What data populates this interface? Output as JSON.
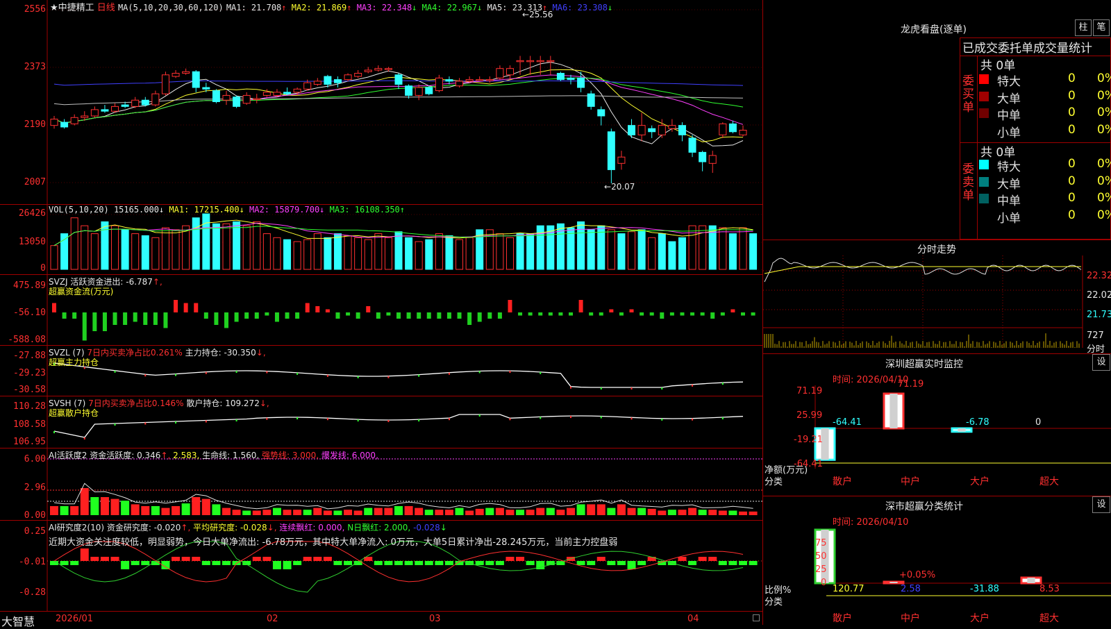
{
  "app": {
    "brand": "大智慧"
  },
  "main": {
    "title": "★中捷精工",
    "period": "日线",
    "ma_text": "MA(5,10,20,30,60,120)",
    "ma": [
      {
        "label": "MA1:",
        "value": "21.708",
        "dir": "↑",
        "color": "#e8e8e8"
      },
      {
        "label": "MA2:",
        "value": "21.869",
        "dir": "↑",
        "color": "#ffff30"
      },
      {
        "label": "MA3:",
        "value": "22.348",
        "dir": "↓",
        "color": "#ff40ff"
      },
      {
        "label": "MA4:",
        "value": "22.967",
        "dir": "↓",
        "color": "#30ff30"
      },
      {
        "label": "MA5:",
        "value": "23.313",
        "dir": "↑",
        "color": "#e8e8e8"
      },
      {
        "label": "MA6:",
        "value": "23.308",
        "dir": "↓",
        "color": "#4040ff"
      }
    ],
    "y_ticks": [
      "2556",
      "2373",
      "2190",
      "2007"
    ],
    "high_label": "25.56",
    "low_label": "20.07"
  },
  "vol": {
    "header": "VOL(5,10,20)",
    "value": "15165.000↓",
    "ma1": "MA1: 17215.400↓",
    "ma2": "MA2: 15879.700↓",
    "ma3": "MA3: 16108.350↑",
    "y_ticks": [
      "26426",
      "13050",
      "0"
    ]
  },
  "svzj": {
    "header": "SVZJ  活跃资金进出: -6.787",
    "arrow": "↑,",
    "sub": "超赢资金流(万元)",
    "y_ticks": [
      "475.89",
      "-56.10",
      "-588.08"
    ]
  },
  "svzl": {
    "header": "SVZL (7)",
    "red": "7日内买卖净占比0.261%",
    "white": "主力持仓: -30.350",
    "arrow": "↓,",
    "sub": "超赢主力持仓",
    "y_ticks": [
      "-27.88",
      "-29.23",
      "-30.58"
    ]
  },
  "svsh": {
    "header": "SVSH (7)",
    "red": "7日内买卖净占比0.146%",
    "white": "散户持仓: 109.272",
    "arrow": "↓,",
    "sub": "超赢散户持仓",
    "y_ticks": [
      "110.28",
      "108.58",
      "106.95"
    ]
  },
  "ai1": {
    "header": "AI活跃度2",
    "white": "资金活跃度: 0.346",
    "arrow": "↑,",
    "v2": "2.583,",
    "life": "生命线: 1.560,",
    "strong": "强势线: 3.000,",
    "burst": "爆发线: 6.000,",
    "y_ticks": [
      "6.00",
      "2.96",
      "0.00"
    ]
  },
  "ai2": {
    "header": "AI研究度2(10)",
    "white": "资金研究度: -0.020",
    "a1": "↑,",
    "avg": "平均研究度: -0.028",
    "a2": "↓,",
    "lianxu": "连续飘红: 0.000,",
    "nday": "N日飘红: 2.000,",
    "blue": "-0.028",
    "a3": "↓",
    "note": "近期大资金关注度较低，明显弱势，今日大单净流出: -6.78万元，其中特大单净流入: 0万元，大单5日累计净出-28.245万元，当前主力控盘弱",
    "y_ticks": [
      "0.25",
      "-0.01",
      "-0.28"
    ]
  },
  "xaxis": {
    "labels": [
      "2026/01",
      "02",
      "03",
      "04"
    ]
  },
  "dragon": {
    "title": "龙虎看盘(逐单)",
    "btn1": "柱",
    "btn2": "笔",
    "header": "已成交委托单成交量统计",
    "buy_side": "委买单",
    "sell_side": "委卖单",
    "buy_total": "共 0单",
    "sell_total": "共 0单",
    "buy_rows": [
      {
        "label": "特大",
        "count": "0",
        "pct": "0%",
        "color": "#ff0000"
      },
      {
        "label": "大单",
        "count": "0",
        "pct": "0%",
        "color": "#a00000"
      },
      {
        "label": "中单",
        "count": "0",
        "pct": "0%",
        "color": "#700000"
      },
      {
        "label": "小单",
        "count": "0",
        "pct": "0%",
        "color": "#000000"
      }
    ],
    "sell_rows": [
      {
        "label": "特大",
        "count": "0",
        "pct": "0%",
        "color": "#00ffff"
      },
      {
        "label": "大单",
        "count": "0",
        "pct": "0%",
        "color": "#008080"
      },
      {
        "label": "中单",
        "count": "0",
        "pct": "0%",
        "color": "#006060"
      },
      {
        "label": "小单",
        "count": "0",
        "pct": "0%",
        "color": "#000000"
      }
    ]
  },
  "intraday": {
    "title": "分时走势",
    "y_ticks": [
      "22.32",
      "22.02",
      "21.73"
    ],
    "vol_label": "727",
    "vol_unit": "分时"
  },
  "monitor": {
    "title": "深圳超赢实时监控",
    "set": "设",
    "time": "时间: 2026/04/10",
    "y_ticks": [
      "71.19",
      "25.99",
      "-19.21",
      "-64.41"
    ],
    "values": {
      "retail": "-64.41",
      "mid": "71.19",
      "big": "-6.78",
      "super": "0"
    },
    "unit": "净额(万元)",
    "cat": "分类",
    "categories": [
      "散户",
      "中户",
      "大户",
      "超大"
    ]
  },
  "classify": {
    "title": "深市超赢分类统计",
    "set": "设",
    "time": "时间: 2026/04/10",
    "y_ticks": [
      "75",
      "50",
      "25",
      "0"
    ],
    "mid_pct": "+0.05%",
    "unit": "比例%",
    "cat": "分类",
    "values": [
      "120.77",
      "2.58",
      "-31.88",
      "8.53"
    ],
    "categories": [
      "散户",
      "中户",
      "大户",
      "超大"
    ]
  },
  "chart_data": {
    "type": "candlestick",
    "note_units": "price ×100 on axis",
    "candles": [
      {
        "o": 21.9,
        "c": 22.1,
        "h": 22.2,
        "l": 21.8
      },
      {
        "o": 22.0,
        "c": 21.85,
        "h": 22.1,
        "l": 21.8
      },
      {
        "o": 21.95,
        "c": 22.15,
        "h": 22.25,
        "l": 21.9
      },
      {
        "o": 22.15,
        "c": 22.2,
        "h": 22.35,
        "l": 22.05
      },
      {
        "o": 22.2,
        "c": 22.4,
        "h": 22.5,
        "l": 22.15
      },
      {
        "o": 22.4,
        "c": 22.35,
        "h": 22.55,
        "l": 22.3
      },
      {
        "o": 22.35,
        "c": 22.5,
        "h": 22.6,
        "l": 22.3
      },
      {
        "o": 22.55,
        "c": 22.5,
        "h": 22.65,
        "l": 22.45
      },
      {
        "o": 22.5,
        "c": 22.7,
        "h": 22.8,
        "l": 22.45
      },
      {
        "o": 22.7,
        "c": 22.55,
        "h": 22.8,
        "l": 22.5
      },
      {
        "o": 22.55,
        "c": 22.9,
        "h": 23.0,
        "l": 22.5
      },
      {
        "o": 22.9,
        "c": 23.5,
        "h": 23.6,
        "l": 22.85
      },
      {
        "o": 23.45,
        "c": 23.55,
        "h": 23.65,
        "l": 23.4
      },
      {
        "o": 23.55,
        "c": 23.6,
        "h": 23.7,
        "l": 23.5
      },
      {
        "o": 23.6,
        "c": 23.1,
        "h": 23.65,
        "l": 22.95
      },
      {
        "o": 23.1,
        "c": 23.05,
        "h": 23.25,
        "l": 22.95
      },
      {
        "o": 23.0,
        "c": 22.65,
        "h": 23.05,
        "l": 22.6
      },
      {
        "o": 22.7,
        "c": 22.85,
        "h": 23.0,
        "l": 22.55
      },
      {
        "o": 22.8,
        "c": 22.5,
        "h": 22.85,
        "l": 22.45
      },
      {
        "o": 22.6,
        "c": 22.85,
        "h": 22.95,
        "l": 22.55
      },
      {
        "o": 22.75,
        "c": 22.75,
        "h": 22.9,
        "l": 22.6
      },
      {
        "o": 22.85,
        "c": 22.95,
        "h": 23.05,
        "l": 22.8
      },
      {
        "o": 22.85,
        "c": 22.95,
        "h": 23.05,
        "l": 22.8
      },
      {
        "o": 22.95,
        "c": 22.9,
        "h": 23.1,
        "l": 22.85
      },
      {
        "o": 22.95,
        "c": 23.05,
        "h": 23.1,
        "l": 22.85
      },
      {
        "o": 23.05,
        "c": 23.25,
        "h": 23.35,
        "l": 23.0
      },
      {
        "o": 23.2,
        "c": 23.3,
        "h": 23.4,
        "l": 23.15
      },
      {
        "o": 23.45,
        "c": 23.2,
        "h": 23.5,
        "l": 23.1
      },
      {
        "o": 23.35,
        "c": 23.25,
        "h": 23.45,
        "l": 23.1
      },
      {
        "o": 23.35,
        "c": 23.5,
        "h": 23.55,
        "l": 23.3
      },
      {
        "o": 23.45,
        "c": 23.55,
        "h": 23.65,
        "l": 23.4
      },
      {
        "o": 23.6,
        "c": 23.65,
        "h": 23.75,
        "l": 23.55
      },
      {
        "o": 23.65,
        "c": 23.7,
        "h": 23.8,
        "l": 23.6
      },
      {
        "o": 23.7,
        "c": 23.7,
        "h": 23.75,
        "l": 23.6
      },
      {
        "o": 23.5,
        "c": 23.2,
        "h": 23.55,
        "l": 23.05
      },
      {
        "o": 23.15,
        "c": 22.85,
        "h": 23.2,
        "l": 22.75
      },
      {
        "o": 22.85,
        "c": 23.1,
        "h": 23.2,
        "l": 22.7
      },
      {
        "o": 23.1,
        "c": 22.9,
        "h": 23.15,
        "l": 22.85
      },
      {
        "o": 23.0,
        "c": 23.4,
        "h": 23.5,
        "l": 22.95
      },
      {
        "o": 23.35,
        "c": 23.3,
        "h": 23.45,
        "l": 23.2
      },
      {
        "o": 23.15,
        "c": 23.3,
        "h": 23.4,
        "l": 23.1
      },
      {
        "o": 23.3,
        "c": 23.35,
        "h": 23.45,
        "l": 23.25
      },
      {
        "o": 23.35,
        "c": 23.35,
        "h": 23.45,
        "l": 23.3
      },
      {
        "o": 23.35,
        "c": 23.35,
        "h": 23.45,
        "l": 23.25
      },
      {
        "o": 23.4,
        "c": 23.7,
        "h": 23.8,
        "l": 23.35
      },
      {
        "o": 23.5,
        "c": 23.7,
        "h": 23.8,
        "l": 23.35
      },
      {
        "o": 23.95,
        "c": 23.95,
        "h": 24.1,
        "l": 23.5
      },
      {
        "o": 23.95,
        "c": 23.95,
        "h": 24.1,
        "l": 23.5
      },
      {
        "o": 23.95,
        "c": 23.95,
        "h": 24.1,
        "l": 23.5
      },
      {
        "o": 23.95,
        "c": 23.95,
        "h": 24.1,
        "l": 23.5
      },
      {
        "o": 23.55,
        "c": 23.35,
        "h": 23.6,
        "l": 23.3
      },
      {
        "o": 23.4,
        "c": 23.35,
        "h": 23.5,
        "l": 23.2
      },
      {
        "o": 23.4,
        "c": 23.1,
        "h": 23.6,
        "l": 22.95
      },
      {
        "o": 22.9,
        "c": 22.5,
        "h": 23.0,
        "l": 22.4
      },
      {
        "o": 22.4,
        "c": 22.2,
        "h": 22.5,
        "l": 21.9
      },
      {
        "o": 21.7,
        "c": 20.5,
        "h": 21.8,
        "l": 20.07
      },
      {
        "o": 20.7,
        "c": 20.9,
        "h": 21.1,
        "l": 20.5
      },
      {
        "o": 21.9,
        "c": 21.6,
        "h": 22.1,
        "l": 21.5
      },
      {
        "o": 21.6,
        "c": 21.9,
        "h": 22.3,
        "l": 21.4
      },
      {
        "o": 21.8,
        "c": 21.7,
        "h": 21.9,
        "l": 21.5
      },
      {
        "o": 21.6,
        "c": 21.9,
        "h": 22.1,
        "l": 21.5
      },
      {
        "o": 21.8,
        "c": 21.9,
        "h": 22.1,
        "l": 21.7
      },
      {
        "o": 21.9,
        "c": 21.6,
        "h": 22.0,
        "l": 21.4
      },
      {
        "o": 21.5,
        "c": 21.05,
        "h": 21.6,
        "l": 20.9
      },
      {
        "o": 21.05,
        "c": 20.75,
        "h": 21.1,
        "l": 20.45
      },
      {
        "o": 20.7,
        "c": 20.95,
        "h": 21.1,
        "l": 20.4
      },
      {
        "o": 21.6,
        "c": 21.95,
        "h": 22.0,
        "l": 21.5
      },
      {
        "o": 21.95,
        "c": 21.7,
        "h": 22.05,
        "l": 21.65
      },
      {
        "o": 21.6,
        "c": 21.75,
        "h": 21.9,
        "l": 21.55
      }
    ],
    "volumes": [
      12,
      18,
      26,
      22,
      18,
      24,
      22,
      20,
      18,
      17,
      16,
      21,
      20,
      22,
      26,
      28,
      23,
      23,
      24,
      22,
      24,
      18,
      16,
      15,
      14,
      15,
      18,
      16,
      18,
      17,
      16,
      15,
      18,
      16,
      19,
      16,
      14,
      15,
      18,
      17,
      15,
      16,
      20,
      20,
      18,
      16,
      18,
      18,
      22,
      22,
      23,
      21,
      24,
      20,
      22,
      20,
      18,
      19,
      20,
      16,
      18,
      14,
      16,
      22,
      22,
      22,
      21,
      18,
      21,
      18
    ],
    "rising": [
      1,
      0,
      1,
      1,
      1,
      0,
      1,
      0,
      1,
      0,
      1,
      1,
      1,
      1,
      0,
      0,
      0,
      1,
      0,
      1,
      1,
      1,
      1,
      0,
      1,
      1,
      1,
      0,
      0,
      1,
      1,
      1,
      1,
      1,
      0,
      0,
      1,
      0,
      1,
      0,
      1,
      1,
      0,
      1,
      1,
      1,
      0,
      0,
      0,
      0,
      0,
      0,
      0,
      0,
      0,
      1,
      0,
      1,
      0,
      1,
      0,
      0,
      0,
      1,
      1,
      0,
      1,
      0,
      1,
      0
    ]
  }
}
